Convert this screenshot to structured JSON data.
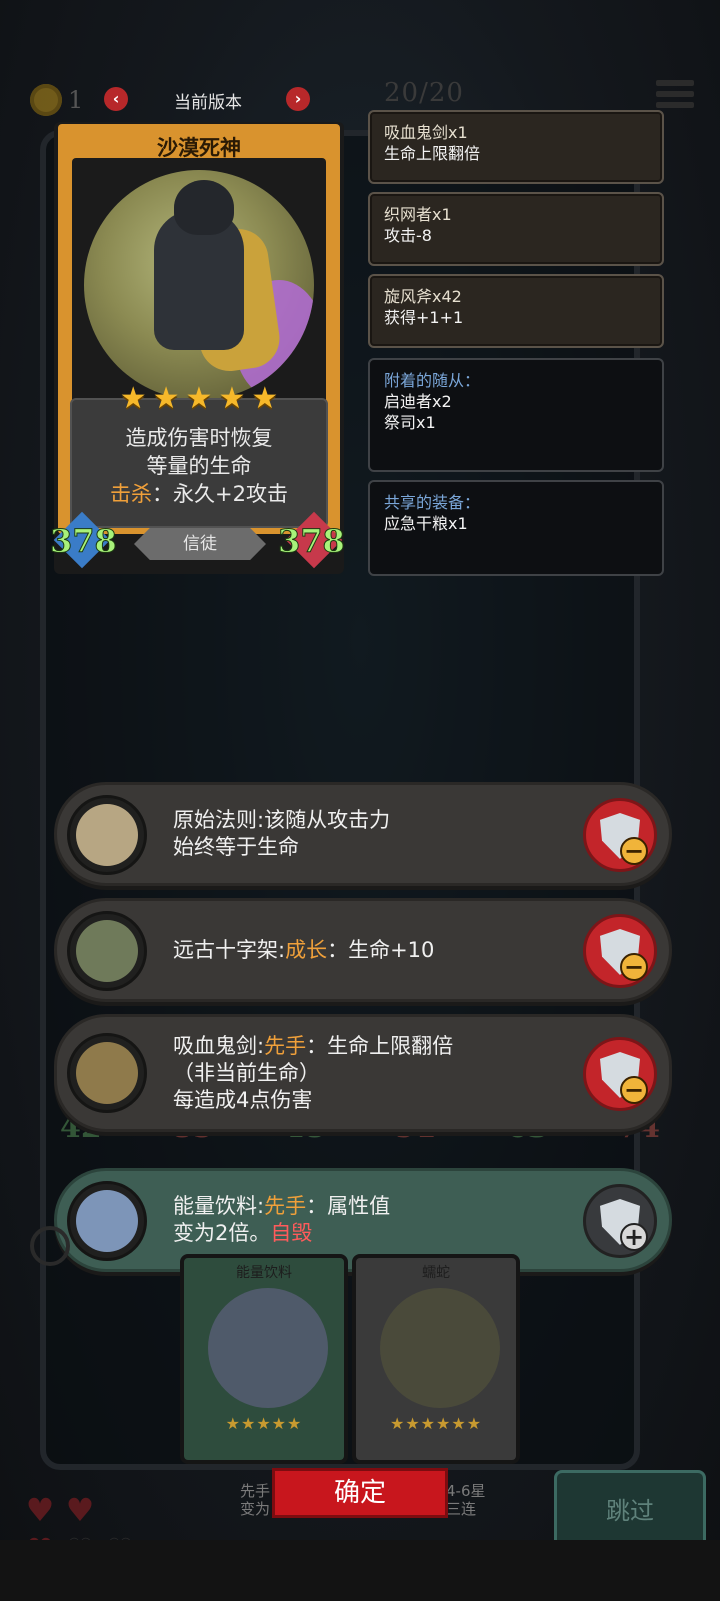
{
  "topbar": {
    "coin_count": "1",
    "version_label": "当前版本",
    "capacity": "20/20"
  },
  "card": {
    "name": "沙漠死神",
    "stars": 5,
    "desc_line1": "造成伤害时恢复",
    "desc_line2": "等量的生命",
    "kill_keyword": "击杀",
    "kill_effect": "：永久+2攻击",
    "attack": "378",
    "health": "378",
    "tribe": "信徒"
  },
  "info_panels": [
    {
      "title": "吸血鬼剑x1",
      "detail": "生命上限翻倍"
    },
    {
      "title": "织网者x1",
      "detail": "攻击-8"
    },
    {
      "title": "旋风斧x42",
      "detail": "获得+1+1"
    }
  ],
  "attached": {
    "header": "附着的随从：",
    "items": [
      "启迪者x2",
      "祭司x1"
    ]
  },
  "shared": {
    "header": "共享的装备：",
    "items": [
      "应急干粮x1"
    ]
  },
  "relics": [
    {
      "name": "原始法则",
      "line1_rest": ":该随从攻击力",
      "line2": "始终等于生命",
      "action": "remove"
    },
    {
      "name": "远古十字架",
      "keyword": "成长",
      "line1_rest": "：生命+10",
      "action": "remove"
    },
    {
      "name": "吸血鬼剑",
      "keyword": "先手",
      "line1_rest": "：生命上限翻倍",
      "line2": "（非当前生命）",
      "line3": "每造成4点伤害",
      "action": "remove"
    },
    {
      "name": "能量饮料",
      "keyword": "先手",
      "line1_rest": "：属性值",
      "line2_a": "变为2倍。",
      "line2_kw": "自毁",
      "action": "add"
    }
  ],
  "background_stats": [
    "42",
    "85",
    "48",
    "91",
    "63",
    "74"
  ],
  "bottom_cards": [
    {
      "name": "能量饮料",
      "stars": 5,
      "text_fragment": "先手\n变为"
    },
    {
      "name": "蠕蛇",
      "stars": 6,
      "text_fragment": "4-6星\n三连"
    }
  ],
  "buttons": {
    "confirm": "确定",
    "skip": "跳过"
  },
  "colors": {
    "keyword_orange": "#f0a03a",
    "keyword_red": "#ff5b5b",
    "attack_green": "#a8f27a",
    "confirm_red": "#c8161d"
  }
}
